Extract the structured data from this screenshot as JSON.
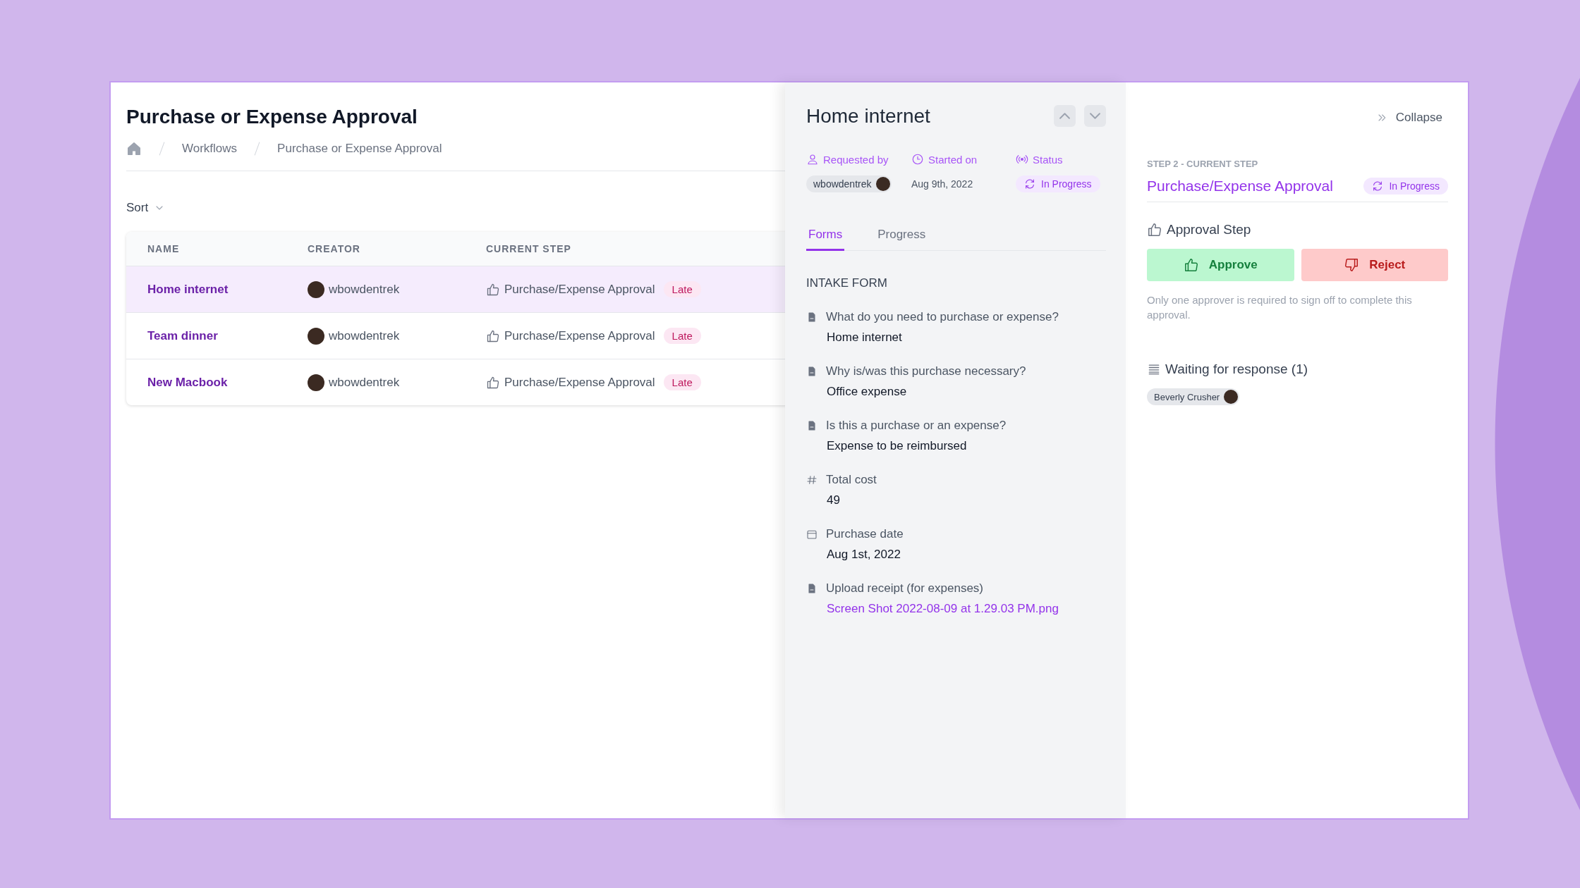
{
  "page": {
    "title": "Purchase or Expense Approval",
    "breadcrumb": [
      "Workflows",
      "Purchase or Expense Approval"
    ],
    "sort_label": "Sort"
  },
  "table": {
    "columns": [
      "NAME",
      "CREATOR",
      "CURRENT STEP"
    ],
    "rows": [
      {
        "name": "Home internet",
        "creator": "wbowdentrek",
        "step": "Purchase/Expense Approval",
        "badge": "Late",
        "selected": true
      },
      {
        "name": "Team dinner",
        "creator": "wbowdentrek",
        "step": "Purchase/Expense Approval",
        "badge": "Late",
        "selected": false
      },
      {
        "name": "New Macbook",
        "creator": "wbowdentrek",
        "step": "Purchase/Expense Approval",
        "badge": "Late",
        "selected": false
      }
    ]
  },
  "detail": {
    "title": "Home internet",
    "requested_by_label": "Requested by",
    "started_on_label": "Started on",
    "status_label": "Status",
    "requester": "wbowdentrek",
    "started_on": "Aug 9th, 2022",
    "status": "In Progress",
    "tabs": [
      {
        "label": "Forms",
        "selected": true
      },
      {
        "label": "Progress",
        "selected": false
      }
    ],
    "section_title": "INTAKE FORM",
    "fields": [
      {
        "kind": "text",
        "label": "What do you need to purchase or expense?",
        "value": "Home internet"
      },
      {
        "kind": "text",
        "label": "Why is/was this purchase necessary?",
        "value": "Office expense"
      },
      {
        "kind": "text",
        "label": "Is this a purchase or an expense?",
        "value": "Expense to be reimbursed"
      },
      {
        "kind": "number",
        "label": "Total cost",
        "value": "49"
      },
      {
        "kind": "date",
        "label": "Purchase date",
        "value": "Aug 1st, 2022"
      },
      {
        "kind": "file",
        "label": "Upload receipt (for expenses)",
        "value": "Screen Shot 2022-08-09 at 1.29.03 PM.png"
      }
    ]
  },
  "step_panel": {
    "collapse": "Collapse",
    "step_label": "STEP 2 - CURRENT STEP",
    "step_title": "Purchase/Expense Approval",
    "status": "In Progress",
    "section_title": "Approval Step",
    "approve": "Approve",
    "reject": "Reject",
    "note": "Only one approver is required to sign off to complete this approval.",
    "waiting_title": "Waiting for response (1)",
    "waiting": [
      "Beverly Crusher"
    ]
  }
}
